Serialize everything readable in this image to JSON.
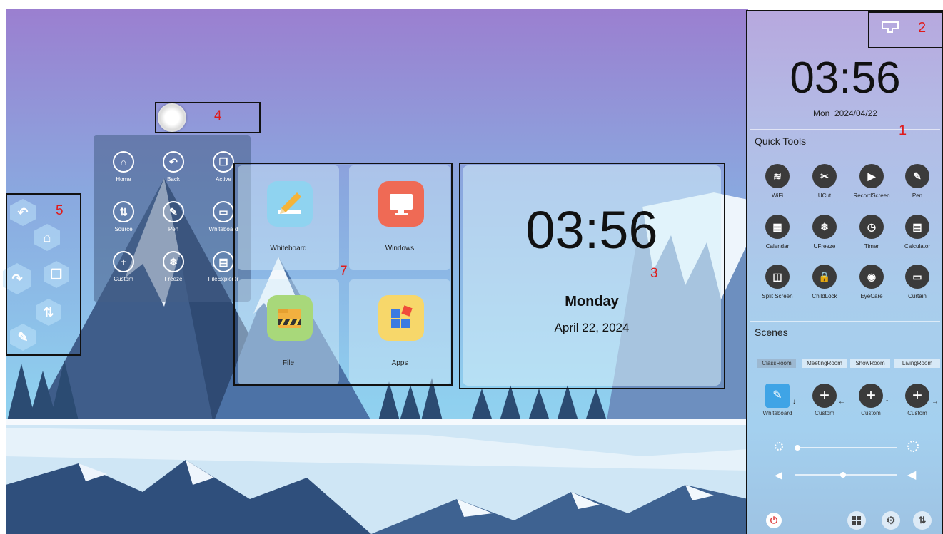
{
  "float_menu": {
    "items": [
      {
        "label": "Home",
        "icon": "home-icon",
        "glyph": "⌂"
      },
      {
        "label": "Back",
        "icon": "back-icon",
        "glyph": "↶"
      },
      {
        "label": "Active",
        "icon": "active-icon",
        "glyph": "❐"
      },
      {
        "label": "Source",
        "icon": "source-icon",
        "glyph": "⇅"
      },
      {
        "label": "Pen",
        "icon": "pen-icon",
        "glyph": "✎"
      },
      {
        "label": "Whiteboard",
        "icon": "whiteboard-icon",
        "glyph": "▭"
      },
      {
        "label": "Custom",
        "icon": "plus-icon",
        "glyph": "+"
      },
      {
        "label": "Freeze",
        "icon": "freeze-icon",
        "glyph": "❄"
      },
      {
        "label": "FileExplorer",
        "icon": "file-explorer-icon",
        "glyph": "▤"
      }
    ]
  },
  "side_toolbar": {
    "buttons": [
      {
        "icon": "back-icon",
        "glyph": "↶"
      },
      {
        "icon": "home-icon",
        "glyph": "⌂"
      },
      {
        "icon": "forward-icon",
        "glyph": "↷"
      },
      {
        "icon": "window-icon",
        "glyph": "❐"
      },
      {
        "icon": "source-icon",
        "glyph": "⇅"
      },
      {
        "icon": "pen-icon",
        "glyph": "✎"
      }
    ]
  },
  "apps": {
    "tiles": [
      {
        "label": "Whiteboard",
        "icon": "whiteboard-app-icon",
        "color": "#8fd3f0"
      },
      {
        "label": "Windows",
        "icon": "windows-app-icon",
        "color": "#ef6a55"
      },
      {
        "label": "File",
        "icon": "file-app-icon",
        "color": "#a8d87a"
      },
      {
        "label": "Apps",
        "icon": "apps-app-icon",
        "color": "#f7d76a"
      }
    ]
  },
  "clock_widget": {
    "time": "03:56",
    "day": "Monday",
    "date": "April 22, 2024"
  },
  "right_panel": {
    "time": "03:56",
    "date": "Mon  2024/04/22",
    "quick_tools_title": "Quick Tools",
    "quick_tools": [
      {
        "label": "WiFi",
        "icon": "wifi-icon",
        "glyph": "≋"
      },
      {
        "label": "UCut",
        "icon": "scissors-icon",
        "glyph": "✂"
      },
      {
        "label": "RecordScreen",
        "icon": "record-screen-icon",
        "glyph": "▶"
      },
      {
        "label": "Pen",
        "icon": "pen-icon",
        "glyph": "✎"
      },
      {
        "label": "Calendar",
        "icon": "calendar-icon",
        "glyph": "▦"
      },
      {
        "label": "UFreeze",
        "icon": "freeze-icon",
        "glyph": "❄"
      },
      {
        "label": "Timer",
        "icon": "timer-icon",
        "glyph": "◷"
      },
      {
        "label": "Calculator",
        "icon": "calculator-icon",
        "glyph": "▤"
      },
      {
        "label": "Split Screen",
        "icon": "split-screen-icon",
        "glyph": "◫"
      },
      {
        "label": "ChildLock",
        "icon": "lock-icon",
        "glyph": "🔒"
      },
      {
        "label": "EyeCare",
        "icon": "eye-icon",
        "glyph": "◉"
      },
      {
        "label": "Curtain",
        "icon": "curtain-icon",
        "glyph": "▭"
      }
    ],
    "scenes_title": "Scenes",
    "scene_tabs": [
      "ClassRoom",
      "MeetingRoom",
      "ShowRoom",
      "LivingRoom"
    ],
    "active_scene_tab": "ClassRoom",
    "scene_items": [
      {
        "label": "Whiteboard",
        "icon": "whiteboard-icon",
        "arrow": "↓"
      },
      {
        "label": "Custom",
        "icon": "plus-icon",
        "arrow": "←"
      },
      {
        "label": "Custom",
        "icon": "plus-icon",
        "arrow": "↑"
      },
      {
        "label": "Custom",
        "icon": "plus-icon",
        "arrow": "→"
      }
    ],
    "brightness_level": 0.03,
    "volume_level": 0.47,
    "bottom_icons": [
      "power-icon",
      "windows-icon",
      "settings-icon",
      "source-icon"
    ]
  },
  "callouts": [
    "1",
    "2",
    "3",
    "4",
    "5",
    "7"
  ],
  "colors": {
    "callout_red": "#e01a1a",
    "sky_top": "#9b7fd0",
    "sky_bottom": "#8fd0ef",
    "dark_icon": "#3b3b3b",
    "power_red": "#e04040"
  }
}
